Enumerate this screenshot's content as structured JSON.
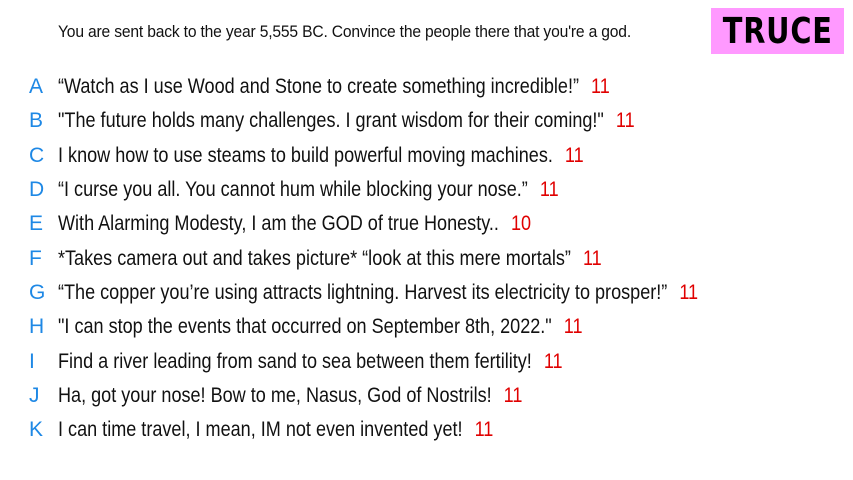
{
  "prompt": "You are sent back to the year 5,555 BC. Convince the people there that you're a god.",
  "badge": {
    "label": "TRUCE",
    "color": "#ff99ff"
  },
  "colors": {
    "letter": "#1e88e5",
    "score": "#e00000"
  },
  "answers": [
    {
      "letter": "A",
      "text": "“Watch as I use Wood and Stone to create something incredible!”",
      "score": "11"
    },
    {
      "letter": "B",
      "text": "\"The future holds many challenges. I grant wisdom for their coming!\"",
      "score": "11"
    },
    {
      "letter": "C",
      "text": "I know how to use steams to build powerful moving machines.",
      "score": "11"
    },
    {
      "letter": "D",
      "text": "“I curse you all. You cannot hum while blocking your nose.”",
      "score": "11"
    },
    {
      "letter": "E",
      "text": "With Alarming Modesty, I am the GOD of true Honesty..",
      "score": "10"
    },
    {
      "letter": "F",
      "text": "*Takes camera out and takes picture* “look at this mere mortals”",
      "score": "11"
    },
    {
      "letter": "G",
      "text": "“The copper you’re using attracts lightning. Harvest its electricity to prosper!”",
      "score": "11"
    },
    {
      "letter": "H",
      "text": "\"I can stop the events that occurred on September 8th, 2022.\"",
      "score": "11"
    },
    {
      "letter": "I",
      "text": "Find a river leading from sand to sea between them fertility!",
      "score": "11"
    },
    {
      "letter": "J",
      "text": "Ha, got your nose! Bow to me, Nasus, God of Nostrils!",
      "score": "11"
    },
    {
      "letter": "K",
      "text": "I can time travel, I mean, IM not even invented yet!",
      "score": "11"
    }
  ]
}
